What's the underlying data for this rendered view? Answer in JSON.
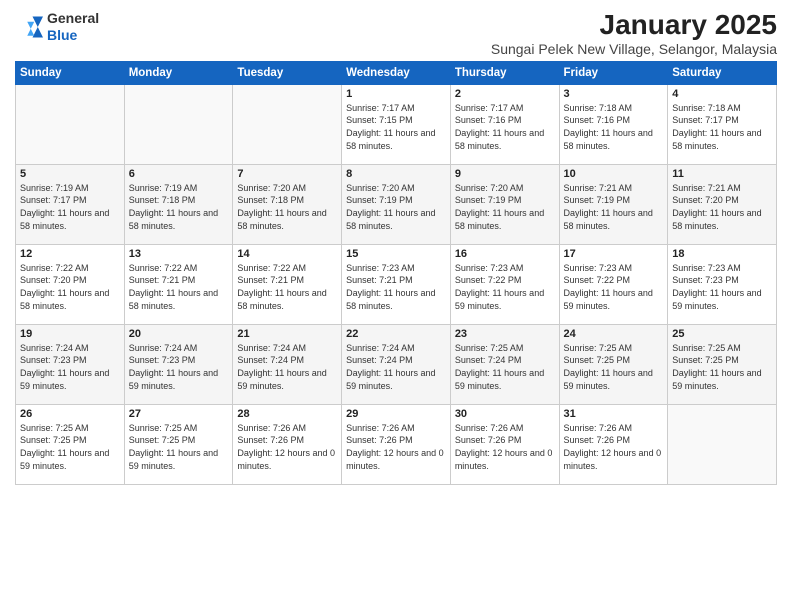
{
  "logo": {
    "general": "General",
    "blue": "Blue"
  },
  "header": {
    "month_title": "January 2025",
    "subtitle": "Sungai Pelek New Village, Selangor, Malaysia"
  },
  "days_of_week": [
    "Sunday",
    "Monday",
    "Tuesday",
    "Wednesday",
    "Thursday",
    "Friday",
    "Saturday"
  ],
  "weeks": [
    [
      {
        "day": "",
        "content": ""
      },
      {
        "day": "",
        "content": ""
      },
      {
        "day": "",
        "content": ""
      },
      {
        "day": "1",
        "content": "Sunrise: 7:17 AM\nSunset: 7:15 PM\nDaylight: 11 hours\nand 58 minutes."
      },
      {
        "day": "2",
        "content": "Sunrise: 7:17 AM\nSunset: 7:16 PM\nDaylight: 11 hours\nand 58 minutes."
      },
      {
        "day": "3",
        "content": "Sunrise: 7:18 AM\nSunset: 7:16 PM\nDaylight: 11 hours\nand 58 minutes."
      },
      {
        "day": "4",
        "content": "Sunrise: 7:18 AM\nSunset: 7:17 PM\nDaylight: 11 hours\nand 58 minutes."
      }
    ],
    [
      {
        "day": "5",
        "content": "Sunrise: 7:19 AM\nSunset: 7:17 PM\nDaylight: 11 hours\nand 58 minutes."
      },
      {
        "day": "6",
        "content": "Sunrise: 7:19 AM\nSunset: 7:18 PM\nDaylight: 11 hours\nand 58 minutes."
      },
      {
        "day": "7",
        "content": "Sunrise: 7:20 AM\nSunset: 7:18 PM\nDaylight: 11 hours\nand 58 minutes."
      },
      {
        "day": "8",
        "content": "Sunrise: 7:20 AM\nSunset: 7:19 PM\nDaylight: 11 hours\nand 58 minutes."
      },
      {
        "day": "9",
        "content": "Sunrise: 7:20 AM\nSunset: 7:19 PM\nDaylight: 11 hours\nand 58 minutes."
      },
      {
        "day": "10",
        "content": "Sunrise: 7:21 AM\nSunset: 7:19 PM\nDaylight: 11 hours\nand 58 minutes."
      },
      {
        "day": "11",
        "content": "Sunrise: 7:21 AM\nSunset: 7:20 PM\nDaylight: 11 hours\nand 58 minutes."
      }
    ],
    [
      {
        "day": "12",
        "content": "Sunrise: 7:22 AM\nSunset: 7:20 PM\nDaylight: 11 hours\nand 58 minutes."
      },
      {
        "day": "13",
        "content": "Sunrise: 7:22 AM\nSunset: 7:21 PM\nDaylight: 11 hours\nand 58 minutes."
      },
      {
        "day": "14",
        "content": "Sunrise: 7:22 AM\nSunset: 7:21 PM\nDaylight: 11 hours\nand 58 minutes."
      },
      {
        "day": "15",
        "content": "Sunrise: 7:23 AM\nSunset: 7:21 PM\nDaylight: 11 hours\nand 58 minutes."
      },
      {
        "day": "16",
        "content": "Sunrise: 7:23 AM\nSunset: 7:22 PM\nDaylight: 11 hours\nand 59 minutes."
      },
      {
        "day": "17",
        "content": "Sunrise: 7:23 AM\nSunset: 7:22 PM\nDaylight: 11 hours\nand 59 minutes."
      },
      {
        "day": "18",
        "content": "Sunrise: 7:23 AM\nSunset: 7:23 PM\nDaylight: 11 hours\nand 59 minutes."
      }
    ],
    [
      {
        "day": "19",
        "content": "Sunrise: 7:24 AM\nSunset: 7:23 PM\nDaylight: 11 hours\nand 59 minutes."
      },
      {
        "day": "20",
        "content": "Sunrise: 7:24 AM\nSunset: 7:23 PM\nDaylight: 11 hours\nand 59 minutes."
      },
      {
        "day": "21",
        "content": "Sunrise: 7:24 AM\nSunset: 7:24 PM\nDaylight: 11 hours\nand 59 minutes."
      },
      {
        "day": "22",
        "content": "Sunrise: 7:24 AM\nSunset: 7:24 PM\nDaylight: 11 hours\nand 59 minutes."
      },
      {
        "day": "23",
        "content": "Sunrise: 7:25 AM\nSunset: 7:24 PM\nDaylight: 11 hours\nand 59 minutes."
      },
      {
        "day": "24",
        "content": "Sunrise: 7:25 AM\nSunset: 7:25 PM\nDaylight: 11 hours\nand 59 minutes."
      },
      {
        "day": "25",
        "content": "Sunrise: 7:25 AM\nSunset: 7:25 PM\nDaylight: 11 hours\nand 59 minutes."
      }
    ],
    [
      {
        "day": "26",
        "content": "Sunrise: 7:25 AM\nSunset: 7:25 PM\nDaylight: 11 hours\nand 59 minutes."
      },
      {
        "day": "27",
        "content": "Sunrise: 7:25 AM\nSunset: 7:25 PM\nDaylight: 11 hours\nand 59 minutes."
      },
      {
        "day": "28",
        "content": "Sunrise: 7:26 AM\nSunset: 7:26 PM\nDaylight: 12 hours\nand 0 minutes."
      },
      {
        "day": "29",
        "content": "Sunrise: 7:26 AM\nSunset: 7:26 PM\nDaylight: 12 hours\nand 0 minutes."
      },
      {
        "day": "30",
        "content": "Sunrise: 7:26 AM\nSunset: 7:26 PM\nDaylight: 12 hours\nand 0 minutes."
      },
      {
        "day": "31",
        "content": "Sunrise: 7:26 AM\nSunset: 7:26 PM\nDaylight: 12 hours\nand 0 minutes."
      },
      {
        "day": "",
        "content": ""
      }
    ]
  ]
}
